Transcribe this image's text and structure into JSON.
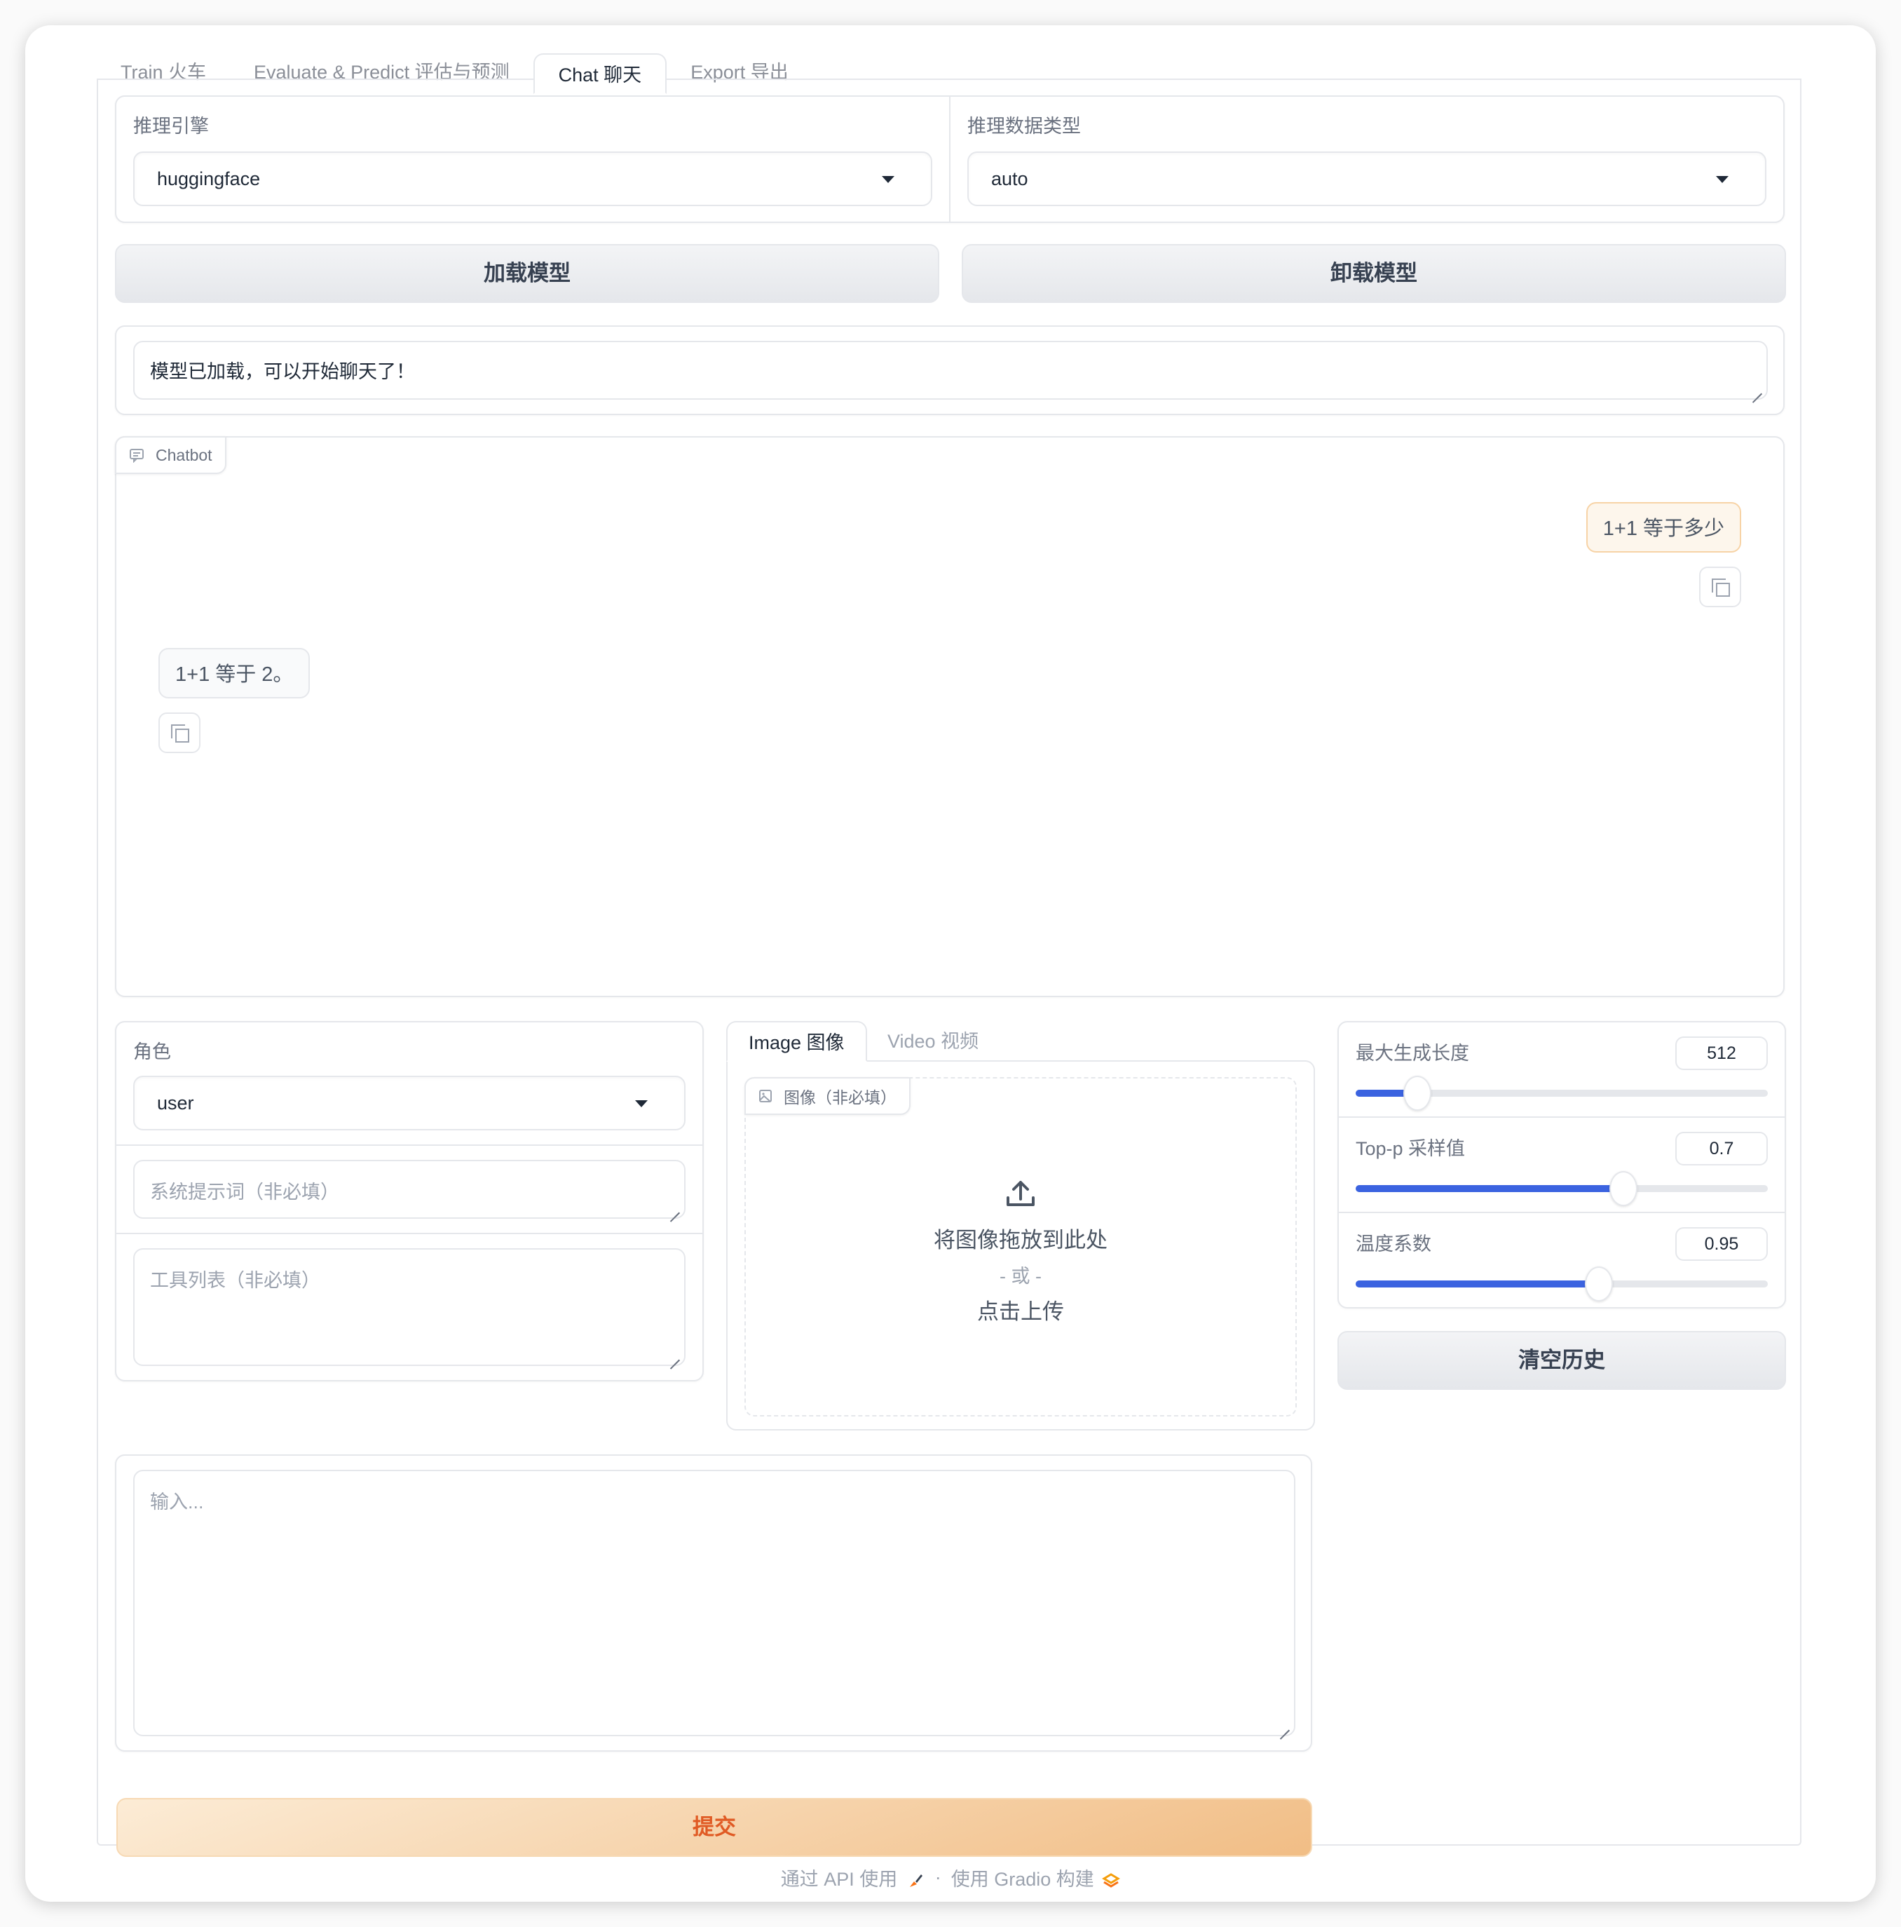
{
  "tabs": [
    {
      "label": "Train 火车",
      "active": false
    },
    {
      "label": "Evaluate & Predict 评估与预测",
      "active": false
    },
    {
      "label": "Chat 聊天",
      "active": true
    },
    {
      "label": "Export 导出",
      "active": false
    }
  ],
  "inference": {
    "engine_label": "推理引擎",
    "engine_value": "huggingface",
    "dtype_label": "推理数据类型",
    "dtype_value": "auto"
  },
  "buttons": {
    "load_model": "加载模型",
    "unload_model": "卸载模型",
    "clear_history": "清空历史",
    "submit": "提交"
  },
  "status": {
    "text": "模型已加载，可以开始聊天了！"
  },
  "chatbot": {
    "label": "Chatbot",
    "messages": [
      {
        "role": "user",
        "text": "1+1 等于多少"
      },
      {
        "role": "assistant",
        "text": "1+1 等于 2。"
      }
    ]
  },
  "role": {
    "label": "角色",
    "value": "user"
  },
  "system_prompt": {
    "placeholder": "系统提示词（非必填）"
  },
  "tools": {
    "placeholder": "工具列表（非必填）"
  },
  "media_tabs": [
    {
      "label": "Image 图像",
      "active": true
    },
    {
      "label": "Video 视频",
      "active": false
    }
  ],
  "image_upload": {
    "label": "图像（非必填）",
    "drop_text": "将图像拖放到此处",
    "or_text": "- 或 -",
    "click_text": "点击上传"
  },
  "sliders": [
    {
      "label": "最大生成长度",
      "value": "512",
      "fill_fraction": 0.15
    },
    {
      "label": "Top-p 采样值",
      "value": "0.7",
      "fill_fraction": 0.65
    },
    {
      "label": "温度系数",
      "value": "0.95",
      "fill_fraction": 0.59
    }
  ],
  "input": {
    "placeholder": "输入..."
  },
  "footer": {
    "api_text": "通过 API 使用",
    "separator": "·",
    "built_text": "使用 Gradio 构建"
  },
  "colors": {
    "accent": "#3b63e0",
    "submit_text": "#e05a24",
    "user_bubble_bg": "#fdf6ec",
    "user_bubble_border": "#f7d3a6"
  }
}
